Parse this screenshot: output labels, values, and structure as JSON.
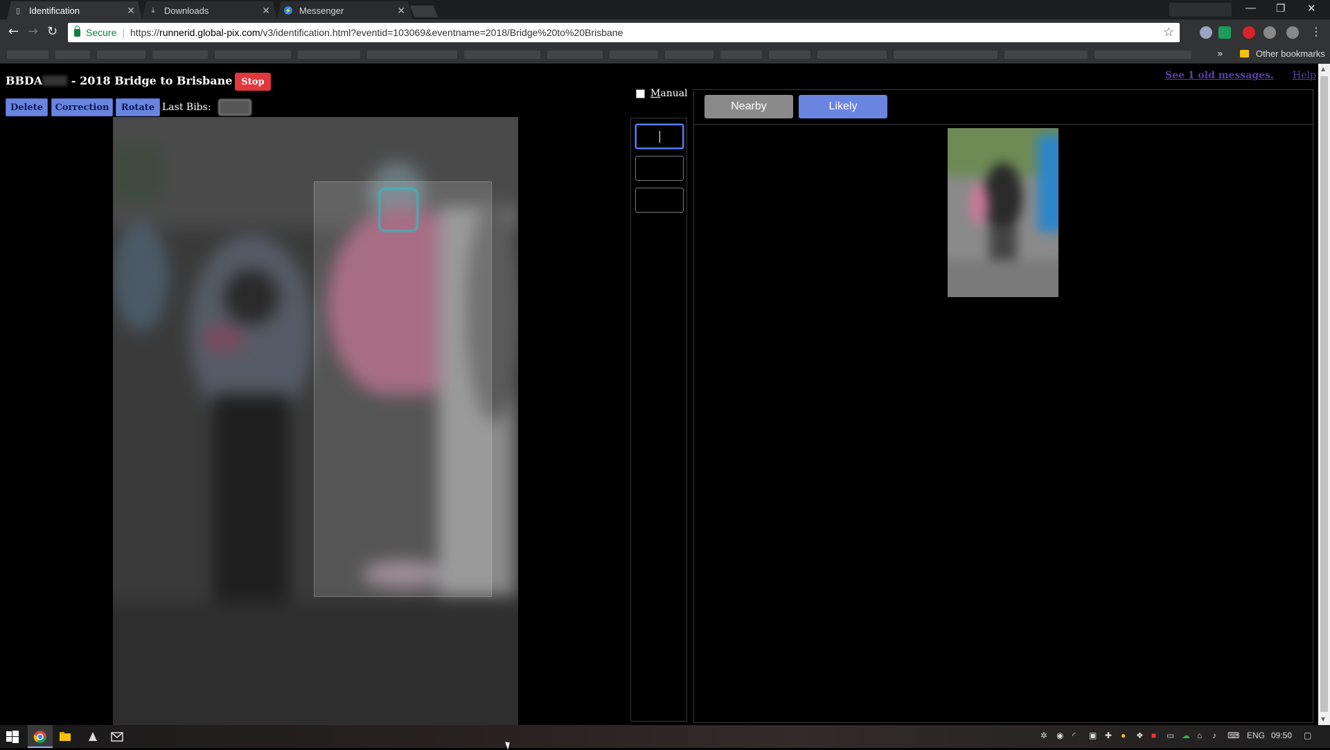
{
  "browser": {
    "tabs": [
      {
        "title": "Identification",
        "active": true,
        "icon": "page-icon"
      },
      {
        "title": "Downloads",
        "active": false,
        "icon": "download-icon"
      },
      {
        "title": "Messenger",
        "active": false,
        "icon": "messenger-icon"
      }
    ],
    "address": {
      "secure_label": "Secure",
      "url_prefix": "https://",
      "url_host": "runnerid.global-pix.com",
      "url_path": "/v3/identification.html?eventid=103069&eventname=2018/Bridge%20to%20Brisbane"
    },
    "bookmarks": {
      "more_label": "»",
      "other_label": "Other bookmarks"
    },
    "window_controls": {
      "minimize": "—",
      "restore": "❐",
      "close": "✕"
    }
  },
  "page": {
    "title_prefix": "BBDA",
    "title_suffix": " - 2018 Bridge to Brisbane",
    "stop_label": "Stop",
    "toolbar": {
      "delete_label": "Delete",
      "correction_label": "Correction",
      "rotate_label": "Rotate",
      "last_bibs_label": "Last Bibs:"
    },
    "manual_label": "Manual",
    "manual_checked": false,
    "bib_inputs": [
      {
        "value": "",
        "focused": true
      },
      {
        "value": "",
        "focused": false
      },
      {
        "value": "",
        "focused": false
      }
    ],
    "panel": {
      "nearby_label": "Nearby",
      "likely_label": "Likely"
    },
    "messages_link": "See 1 old messages.",
    "help_link": "Help"
  },
  "taskbar": {
    "language": "ENG",
    "time": "09:50"
  },
  "colors": {
    "accent_blue": "#6a85e0",
    "stop_red": "#e0383d",
    "link_purple": "#5b3ea6",
    "secure_green": "#0b8043"
  }
}
